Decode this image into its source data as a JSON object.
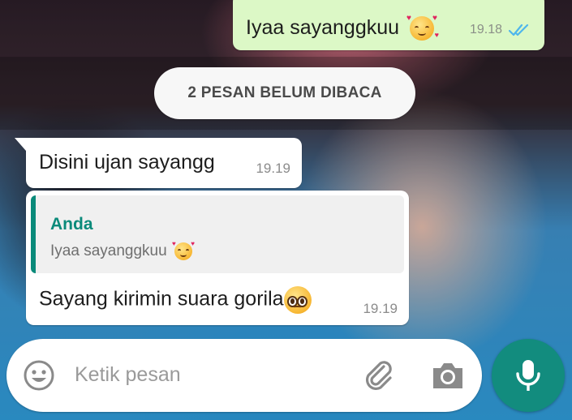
{
  "chat": {
    "outgoing": {
      "text": "Iyaa sayanggkuu",
      "emoji": "smiling-face-with-hearts-icon",
      "time": "19.18",
      "status": "read-double-tick-icon"
    },
    "unread_banner": "2 PESAN BELUM DIBACA",
    "incoming": [
      {
        "text": "Disini ujan sayangg",
        "time": "19.19"
      },
      {
        "quote": {
          "author": "Anda",
          "text": "Iyaa sayanggkuu",
          "emoji": "smiling-face-with-hearts-icon"
        },
        "text": "Sayang kirimin suara gorila",
        "emoji": "pleading-face-icon",
        "time": "19.19"
      }
    ]
  },
  "composer": {
    "placeholder": "Ketik pesan",
    "icons": [
      "emoji-icon",
      "attachment-icon",
      "camera-icon",
      "microphone-icon"
    ]
  },
  "colors": {
    "outgoing_bubble": "#dcf8c6",
    "incoming_bubble": "#ffffff",
    "accent": "#128c7e",
    "quote_accent": "#0a8a7a",
    "read_ticks": "#4fb6ec"
  }
}
